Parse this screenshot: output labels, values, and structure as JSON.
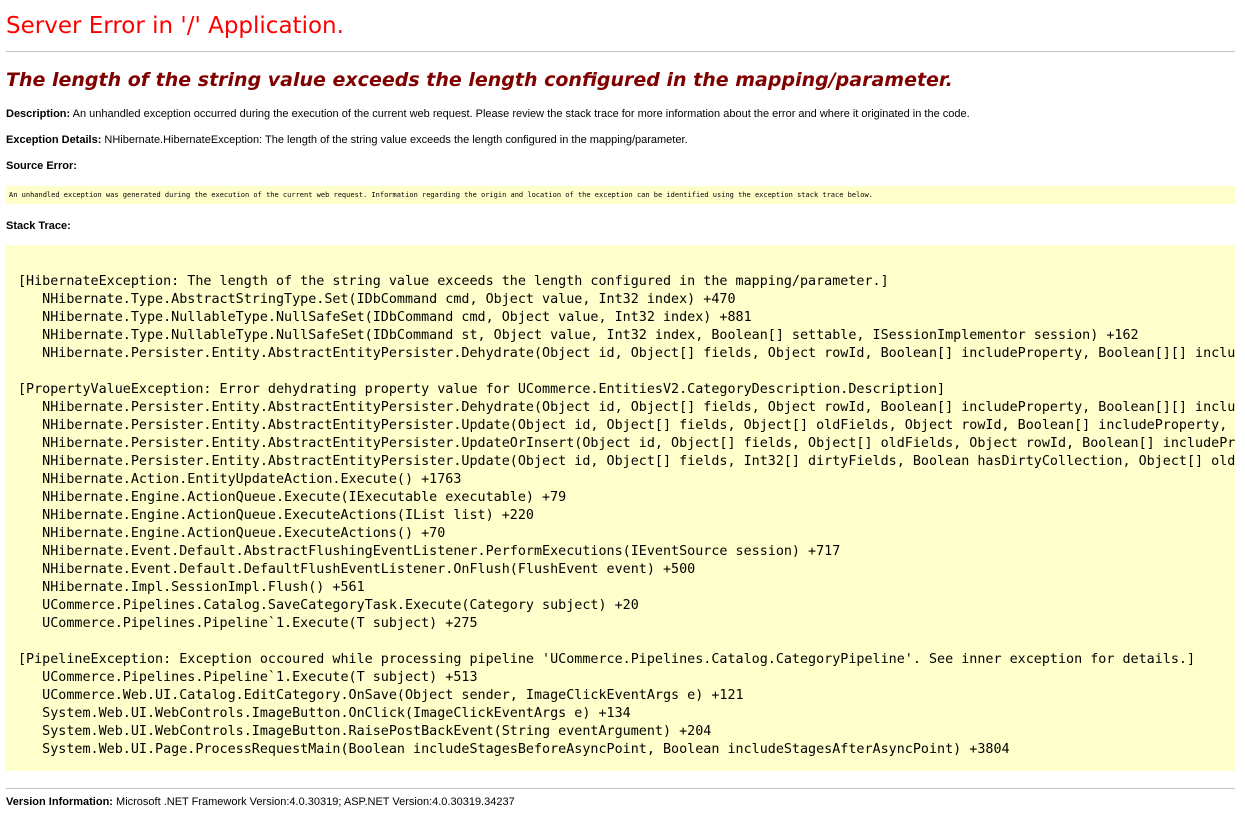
{
  "title": "Server Error in '/' Application.",
  "error_message": "The length of the string value exceeds the length configured in the mapping/parameter.",
  "description": {
    "label": "Description:",
    "text": "An unhandled exception occurred during the execution of the current web request. Please review the stack trace for more information about the error and where it originated in the code."
  },
  "exception_details": {
    "label": "Exception Details:",
    "text": "NHibernate.HibernateException: The length of the string value exceeds the length configured in the mapping/parameter."
  },
  "source_error": {
    "label": "Source Error:",
    "text": "An unhandled exception was generated during the execution of the current web request. Information regarding the origin and location of the exception can be identified using the exception stack trace below."
  },
  "stack_trace": {
    "label": "Stack Trace:",
    "text": "[HibernateException: The length of the string value exceeds the length configured in the mapping/parameter.]\n   NHibernate.Type.AbstractStringType.Set(IDbCommand cmd, Object value, Int32 index) +470\n   NHibernate.Type.NullableType.NullSafeSet(IDbCommand cmd, Object value, Int32 index) +881\n   NHibernate.Type.NullableType.NullSafeSet(IDbCommand st, Object value, Int32 index, Boolean[] settable, ISessionImplementor session) +162\n   NHibernate.Persister.Entity.AbstractEntityPersister.Dehydrate(Object id, Object[] fields, Object rowId, Boolean[] includeProperty, Boolean[][] inclu\n\n[PropertyValueException: Error dehydrating property value for UCommerce.EntitiesV2.CategoryDescription.Description]\n   NHibernate.Persister.Entity.AbstractEntityPersister.Dehydrate(Object id, Object[] fields, Object rowId, Boolean[] includeProperty, Boolean[][] inclu\n   NHibernate.Persister.Entity.AbstractEntityPersister.Update(Object id, Object[] fields, Object[] oldFields, Object rowId, Boolean[] includeProperty, I\n   NHibernate.Persister.Entity.AbstractEntityPersister.UpdateOrInsert(Object id, Object[] fields, Object[] oldFields, Object rowId, Boolean[] includePro\n   NHibernate.Persister.Entity.AbstractEntityPersister.Update(Object id, Object[] fields, Int32[] dirtyFields, Boolean hasDirtyCollection, Object[] oldF\n   NHibernate.Action.EntityUpdateAction.Execute() +1763\n   NHibernate.Engine.ActionQueue.Execute(IExecutable executable) +79\n   NHibernate.Engine.ActionQueue.ExecuteActions(IList list) +220\n   NHibernate.Engine.ActionQueue.ExecuteActions() +70\n   NHibernate.Event.Default.AbstractFlushingEventListener.PerformExecutions(IEventSource session) +717\n   NHibernate.Event.Default.DefaultFlushEventListener.OnFlush(FlushEvent event) +500\n   NHibernate.Impl.SessionImpl.Flush() +561\n   UCommerce.Pipelines.Catalog.SaveCategoryTask.Execute(Category subject) +20\n   UCommerce.Pipelines.Pipeline`1.Execute(T subject) +275\n\n[PipelineException: Exception occoured while processing pipeline 'UCommerce.Pipelines.Catalog.CategoryPipeline'. See inner exception for details.]\n   UCommerce.Pipelines.Pipeline`1.Execute(T subject) +513\n   UCommerce.Web.UI.Catalog.EditCategory.OnSave(Object sender, ImageClickEventArgs e) +121\n   System.Web.UI.WebControls.ImageButton.OnClick(ImageClickEventArgs e) +134\n   System.Web.UI.WebControls.ImageButton.RaisePostBackEvent(String eventArgument) +204\n   System.Web.UI.Page.ProcessRequestMain(Boolean includeStagesBeforeAsyncPoint, Boolean includeStagesAfterAsyncPoint) +3804"
  },
  "version_info": {
    "label": "Version Information:",
    "text": "Microsoft .NET Framework Version:4.0.30319; ASP.NET Version:4.0.30319.34237"
  },
  "colors": {
    "title": "#ff0000",
    "error_message": "#800000",
    "code_background": "#ffffcc",
    "rule": "#c0c0c0"
  }
}
